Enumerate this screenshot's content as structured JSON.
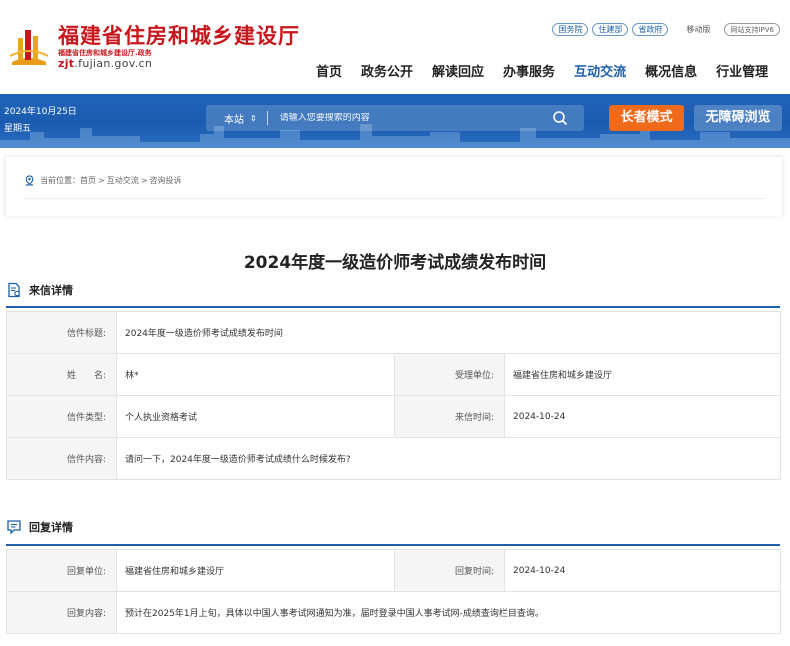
{
  "header": {
    "site_title": "福建省住房和城乡建设厅",
    "site_subtitle": "福建省住房和城乡建设厅.政务",
    "domain_highlight": "zjt",
    "domain_rest": ".fujian.gov.cn",
    "top_links": [
      "国务院",
      "住建部",
      "省政府"
    ],
    "mobile_label": "移动版",
    "ipv6_label": "网站支持IPV6",
    "nav": [
      "首页",
      "政务公开",
      "解读回应",
      "办事服务",
      "互动交流",
      "概况信息",
      "行业管理"
    ],
    "active_nav": "互动交流"
  },
  "banner": {
    "date": "2024年10月25日",
    "weekday": "星期五",
    "search_scope": "本站",
    "search_scope_arrow": "▲▼",
    "search_placeholder": "请输入您要搜索的内容",
    "elder_mode_label": "长者模式",
    "accessible_label": "无障碍浏览",
    "colors": {
      "banner_blue": "#1f63b8",
      "elder_orange": "#f06a1c"
    }
  },
  "breadcrumb": {
    "prefix": "当前位置：",
    "items": [
      "首页",
      "互动交流",
      "咨询投诉"
    ],
    "separator": ">"
  },
  "article": {
    "title": "2024年度一级造价师考试成绩发布时间"
  },
  "letter_section": {
    "heading": "来信详情",
    "rows": {
      "subject_label": "信件标题:",
      "subject_value": "2024年度一级造价师考试成绩发布时间",
      "name_label": "姓　　名:",
      "name_value": "林*",
      "dept_label": "受理单位:",
      "dept_value": "福建省住房和城乡建设厅",
      "type_label": "信件类型:",
      "type_value": "个人执业资格考试",
      "date_label": "来信时间:",
      "date_value": "2024-10-24",
      "content_label": "信件内容:",
      "content_value": "请问一下，2024年度一级造价师考试成绩什么时候发布?"
    }
  },
  "reply_section": {
    "heading": "回复详情",
    "rows": {
      "unit_label": "回复单位:",
      "unit_value": "福建省住房和城乡建设厅",
      "time_label": "回复时间:",
      "time_value": "2024-10-24",
      "content_label": "回复内容:",
      "content_value": "预计在2025年1月上旬，具体以中国人事考试网通知为准，届时登录中国人事考试网-成绩查询栏目查询。"
    }
  }
}
